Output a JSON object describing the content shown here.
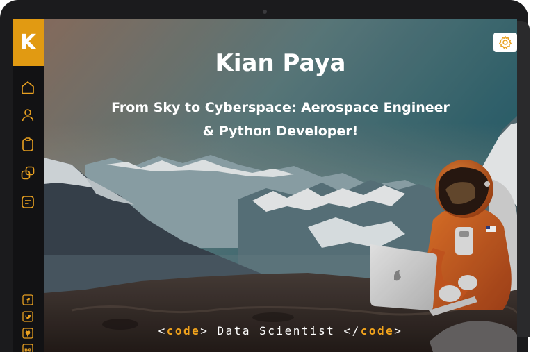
{
  "sidebar": {
    "logo_letter": "K",
    "nav": [
      {
        "name": "home-icon"
      },
      {
        "name": "user-icon"
      },
      {
        "name": "clipboard-icon"
      },
      {
        "name": "portfolio-icon"
      },
      {
        "name": "contact-icon"
      }
    ],
    "social": [
      {
        "name": "facebook-icon",
        "glyph": "f"
      },
      {
        "name": "twitter-icon"
      },
      {
        "name": "github-icon"
      },
      {
        "name": "behance-icon",
        "glyph": "Bē"
      }
    ]
  },
  "hero": {
    "name": "Kian Paya",
    "subtitle_line1": "From Sky to Cyberspace: Aerospace  Engineer",
    "subtitle_line2": "& Python Developer!",
    "code_open_left": "<",
    "code_open_kw": "code",
    "code_open_right": ">",
    "role": " Data Scientist ",
    "code_close_left": "</",
    "code_close_kw": "code",
    "code_close_right": ">"
  },
  "colors": {
    "accent": "#e19a12",
    "sidebar": "#121214",
    "bezel": "#1b1b1d"
  }
}
